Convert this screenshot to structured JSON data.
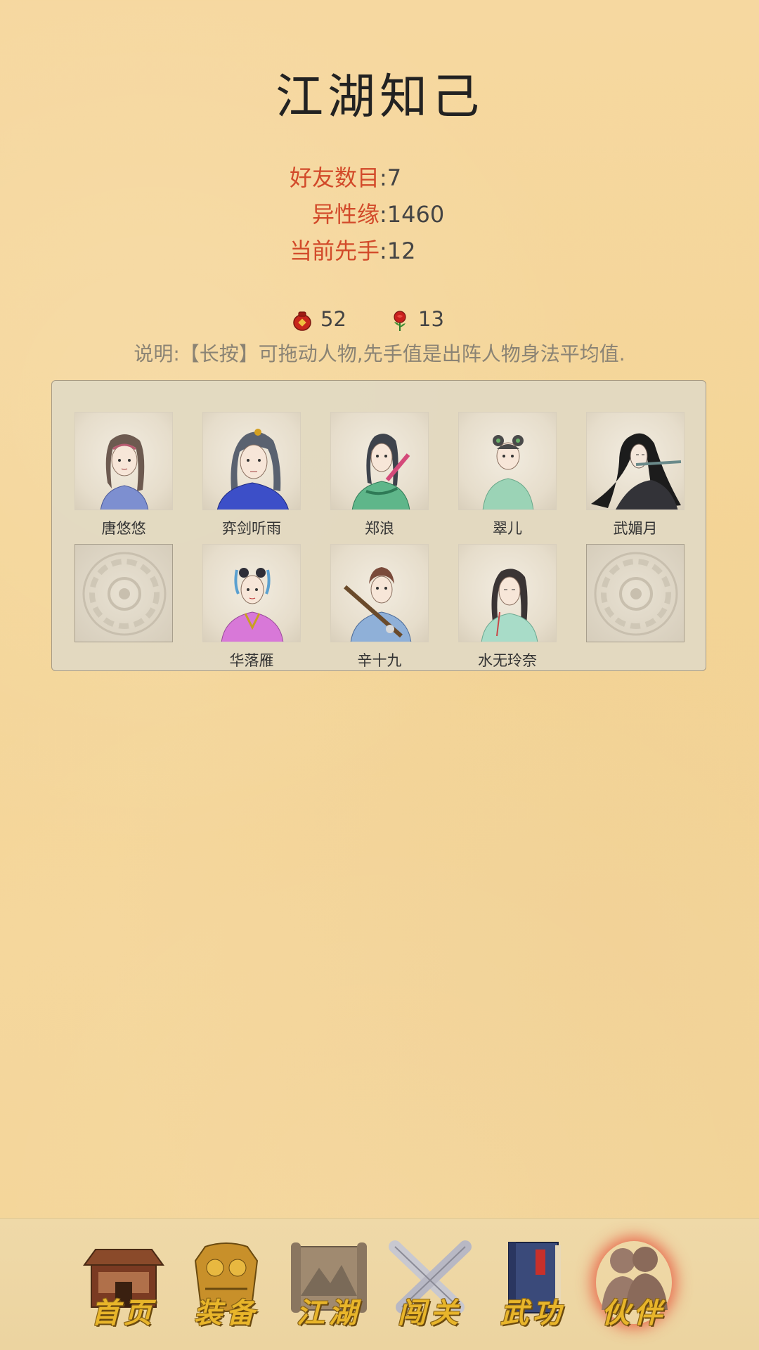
{
  "title": "江湖知己",
  "stats": [
    {
      "label": "好友数目",
      "sep": ":",
      "value": "7"
    },
    {
      "label": "异性缘",
      "sep": ":",
      "value": "1460"
    },
    {
      "label": "当前先手",
      "sep": ":",
      "value": "12"
    }
  ],
  "resources": [
    {
      "icon": "wine-jar-icon",
      "value": "52"
    },
    {
      "icon": "rose-icon",
      "value": "13"
    }
  ],
  "note": "说明:【长按】可拖动人物,先手值是出阵人物身法平均值.",
  "characters": [
    {
      "name": "唐悠悠",
      "icon": "portrait-tang-youyou"
    },
    {
      "name": "弈剑听雨",
      "icon": "portrait-yijian-tingyu"
    },
    {
      "name": "郑浪",
      "icon": "portrait-zheng-lang"
    },
    {
      "name": "翠儿",
      "icon": "portrait-cui-er"
    },
    {
      "name": "武媚月",
      "icon": "portrait-wu-meiyue"
    },
    {
      "name": "",
      "icon": "empty-slot-icon"
    },
    {
      "name": "华落雁",
      "icon": "portrait-hua-luoyan"
    },
    {
      "name": "辛十九",
      "icon": "portrait-xin-shijiu"
    },
    {
      "name": "水无玲奈",
      "icon": "portrait-shui-wulingnai"
    },
    {
      "name": "",
      "icon": "empty-slot-icon"
    }
  ],
  "nav": [
    {
      "label": "首页",
      "icon": "house-icon",
      "active": false
    },
    {
      "label": "装备",
      "icon": "armor-icon",
      "active": false
    },
    {
      "label": "江湖",
      "icon": "scroll-map-icon",
      "active": false
    },
    {
      "label": "闯关",
      "icon": "crossed-swords-icon",
      "active": false
    },
    {
      "label": "武功",
      "icon": "book-icon",
      "active": false
    },
    {
      "label": "伙伴",
      "icon": "partners-icon",
      "active": true
    }
  ],
  "colors": {
    "stat_label": "#d24a2a",
    "nav_text": "#e8b52a",
    "active_glow": "#e63c28"
  }
}
